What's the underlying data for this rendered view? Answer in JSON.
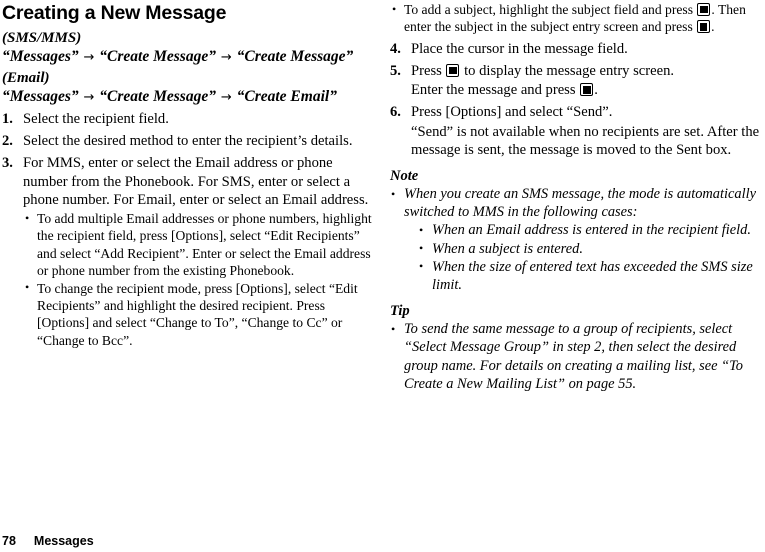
{
  "page": {
    "title": "Creating a New Message",
    "footer": {
      "page_number": "78",
      "section": "Messages"
    }
  },
  "left_column": {
    "mode_sms_mms_label": "(SMS/MMS)",
    "breadcrumb_sms_mms": {
      "part1": "“Messages”",
      "arrow1": "→",
      "part2": "“Create Message”",
      "arrow2": "→",
      "part3": "“Create Message”"
    },
    "mode_email_label": "(Email)",
    "breadcrumb_email": {
      "part1": "“Messages”",
      "arrow1": "→",
      "part2": "“Create Message”",
      "arrow2": "→",
      "part3": "“Create Email”"
    },
    "steps": [
      {
        "number": "1.",
        "text": "Select the recipient field."
      },
      {
        "number": "2.",
        "text": "Select the desired method to enter the recipient’s details."
      },
      {
        "number": "3.",
        "text": "For MMS, enter or select the Email address or phone number from the Phonebook. For SMS, enter or select a phone number. For Email, enter or select an Email address.",
        "bullets": [
          "To add multiple Email addresses or phone numbers, highlight the recipient field, press [Options], select “Edit Recipients” and select “Add Recipient”. Enter or select the Email address or phone number from the existing Phonebook.",
          "To change the recipient mode, press [Options], select “Edit Recipients” and highlight the desired recipient. Press [Options] and select “Change to To”, “Change to Cc” or “Change to Bcc”."
        ]
      }
    ]
  },
  "right_column": {
    "subject_bullet": {
      "text_part1": "To add a subject, highlight the subject field and press ",
      "icon1": "center-select-key-icon",
      "text_part2": ". Then enter the subject in the subject entry screen and press ",
      "icon2": "center-select-key-icon",
      "text_part3": "."
    },
    "steps": [
      {
        "number": "4.",
        "text": "Place the cursor in the message field."
      },
      {
        "number": "5.",
        "text_part1": "Press ",
        "icon1": "center-select-key-icon",
        "text_part2": " to display the message entry screen.",
        "extra_part1": "Enter the message and press ",
        "icon2": "center-select-key-icon",
        "extra_part2": "."
      },
      {
        "number": "6.",
        "text": "Press [Options] and select “Send”.",
        "extra": "“Send” is not available when no recipients are set. After the message is sent, the message is moved to the Sent box."
      }
    ],
    "note": {
      "heading": "Note",
      "bullets": [
        {
          "text": "When you create an SMS message, the mode is automatically switched to MMS in the following cases:",
          "subbullets": [
            "When an Email address is entered in the recipient field.",
            "When a subject is entered.",
            "When the size of entered text has exceeded the SMS size limit."
          ]
        }
      ]
    },
    "tip": {
      "heading": "Tip",
      "bullets": [
        "To send the same message to a group of recipients, select “Select Message Group” in step 2, then select the desired group name. For details on creating a mailing list, see “To Create a New Mailing List” on page 55."
      ]
    }
  }
}
